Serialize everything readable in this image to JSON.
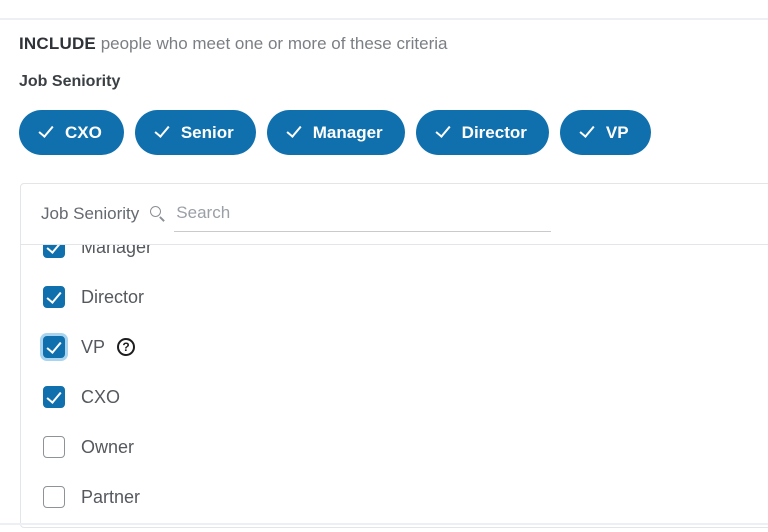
{
  "header": {
    "include_keyword": "INCLUDE",
    "include_rest": " people who meet one or more of these criteria",
    "section_title": "Job Seniority"
  },
  "selected_pills": [
    {
      "label": "CXO",
      "icon": "check-icon"
    },
    {
      "label": "Senior",
      "icon": "check-icon"
    },
    {
      "label": "Manager",
      "icon": "check-icon"
    },
    {
      "label": "Director",
      "icon": "check-icon"
    },
    {
      "label": "VP",
      "icon": "check-icon"
    }
  ],
  "dropdown": {
    "field_label": "Job Seniority",
    "search_icon": "search-icon",
    "search_value": "",
    "search_placeholder": "Search",
    "options": [
      {
        "label": "Manager",
        "checked": true,
        "focused": false,
        "help": false
      },
      {
        "label": "Director",
        "checked": true,
        "focused": false,
        "help": false
      },
      {
        "label": "VP",
        "checked": true,
        "focused": true,
        "help": true,
        "help_glyph": "?"
      },
      {
        "label": "CXO",
        "checked": true,
        "focused": false,
        "help": false
      },
      {
        "label": "Owner",
        "checked": false,
        "focused": false,
        "help": false
      },
      {
        "label": "Partner",
        "checked": false,
        "focused": false,
        "help": false
      }
    ]
  },
  "colors": {
    "accent_blue": "#1070ad",
    "focus_ring": "#a8d4ef",
    "border_gray": "#e3e5e8",
    "text_gray": "#55595e"
  }
}
